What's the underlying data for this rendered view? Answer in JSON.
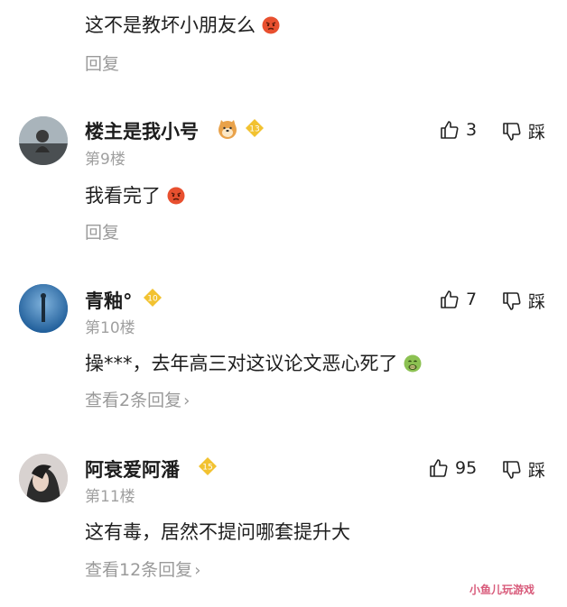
{
  "comments": [
    {
      "text": "这不是教坏小朋友么",
      "text_emoji": "angry-face-emoji",
      "reply": "回复"
    },
    {
      "username": "楼主是我小号",
      "badge_emoji": "shiba-dog-emoji",
      "level": "13",
      "floor": "第9楼",
      "likes": "3",
      "dislike": "踩",
      "text": "我看完了",
      "text_emoji": "angry-face-emoji",
      "reply": "回复"
    },
    {
      "username": "青釉°",
      "level": "10",
      "floor": "第10楼",
      "likes": "7",
      "dislike": "踩",
      "text": "操***，去年高三对这议论文恶心死了",
      "text_emoji": "nauseated-face-emoji",
      "reply": "查看2条回复"
    },
    {
      "username": "阿衰爱阿潘",
      "level": "15",
      "floor": "第11楼",
      "likes": "95",
      "dislike": "踩",
      "text": "这有毒，居然不提问哪套提升大",
      "reply": "查看12条回复"
    }
  ],
  "watermark": "小鱼儿玩游戏",
  "colors": {
    "level_badge": "#f2c230",
    "emoji_angry": "#e8502f",
    "emoji_nauseated": "#8cc152"
  }
}
